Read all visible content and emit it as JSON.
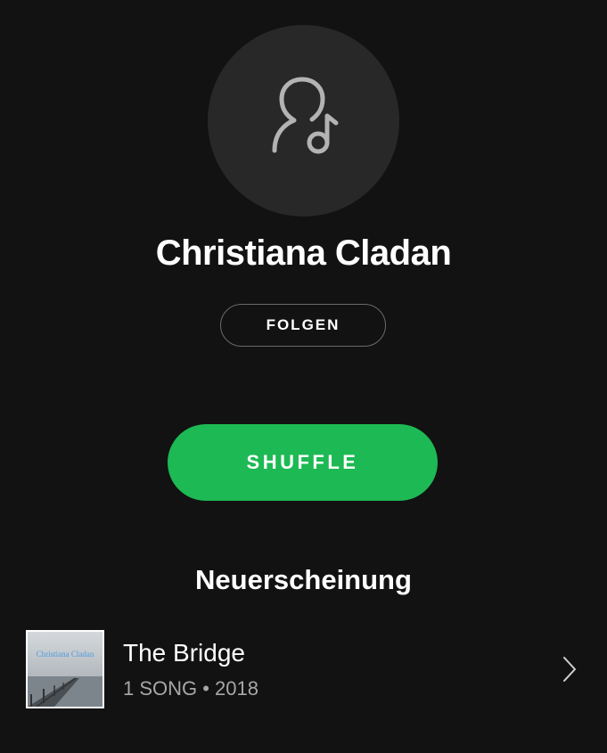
{
  "artist": {
    "name": "Christiana Cladan",
    "avatar_icon": "artist-placeholder-icon"
  },
  "actions": {
    "follow_label": "FOLGEN",
    "shuffle_label": "SHUFFLE"
  },
  "section": {
    "title": "Neuerscheinung"
  },
  "release": {
    "cover_text": "Christiana Cladan",
    "title": "The Bridge",
    "meta": "1 SONG • 2018",
    "chevron_icon": "chevron-right-icon"
  },
  "colors": {
    "background": "#121212",
    "accent": "#1db954",
    "avatar_bg": "#282828",
    "secondary_text": "#a7a7a7"
  }
}
